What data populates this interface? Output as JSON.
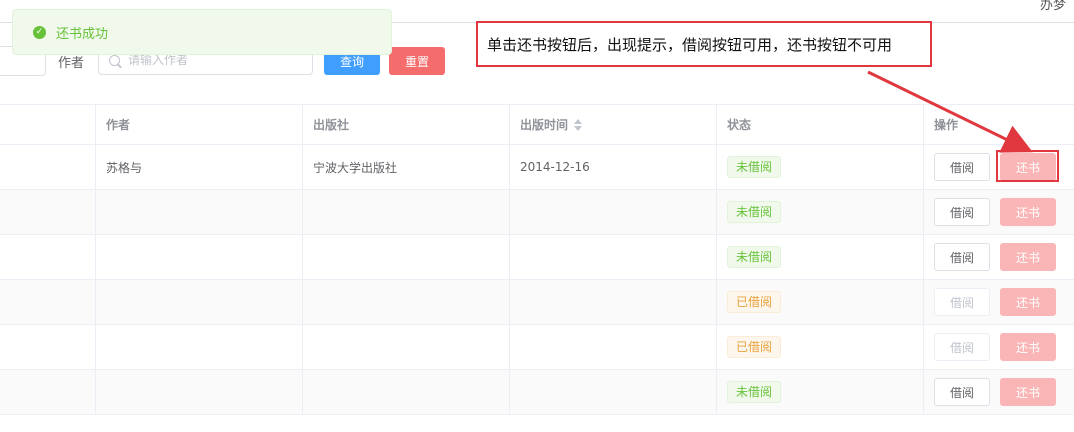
{
  "header": {
    "user_text": "办梦"
  },
  "toast": {
    "message": "还书成功",
    "icon": "success-check-icon"
  },
  "search": {
    "author_label": "作者",
    "author_placeholder": "请输入作者",
    "query_label": "查询",
    "reset_label": "重置"
  },
  "annotation": {
    "text": "单击还书按钮后，出现提示，借阅按钮可用，还书按钮不可用"
  },
  "table": {
    "columns": [
      "",
      "作者",
      "出版社",
      "出版时间",
      "状态",
      "操作"
    ],
    "rows": [
      {
        "author": "苏格与",
        "publisher": "宁波大学出版社",
        "date": "2014-12-16",
        "status": "未借阅",
        "status_color": "green",
        "borrow": "借阅",
        "return": "还书",
        "borrow_disabled": false
      },
      {
        "author": "",
        "publisher": "",
        "date": "",
        "status": "未借阅",
        "status_color": "green",
        "borrow": "借阅",
        "return": "还书",
        "borrow_disabled": false
      },
      {
        "author": "",
        "publisher": "",
        "date": "",
        "status": "未借阅",
        "status_color": "green",
        "borrow": "借阅",
        "return": "还书",
        "borrow_disabled": false
      },
      {
        "author": "",
        "publisher": "",
        "date": "",
        "status": "已借阅",
        "status_color": "orange",
        "borrow": "借阅",
        "return": "还书",
        "borrow_disabled": true
      },
      {
        "author": "",
        "publisher": "",
        "date": "",
        "status": "已借阅",
        "status_color": "orange",
        "borrow": "借阅",
        "return": "还书",
        "borrow_disabled": true
      },
      {
        "author": "",
        "publisher": "",
        "date": "",
        "status": "未借阅",
        "status_color": "green",
        "borrow": "借阅",
        "return": "还书",
        "borrow_disabled": false
      }
    ]
  },
  "colors": {
    "primary": "#409eff",
    "danger": "#f56c6c",
    "success": "#67c23a",
    "warning": "#e6a23c",
    "annotation_red": "#e0383e"
  }
}
